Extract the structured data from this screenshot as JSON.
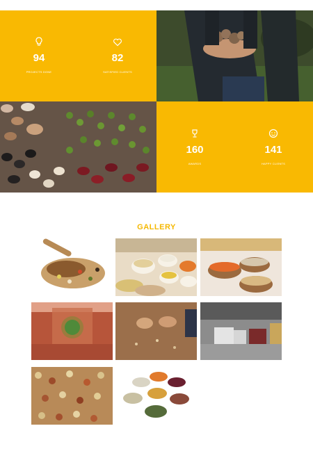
{
  "stats": [
    {
      "number": "94",
      "label": "PROJECTS DONE",
      "icon": "lightbulb-icon"
    },
    {
      "number": "82",
      "label": "SATISFIED CLIENTS",
      "icon": "heart-icon"
    },
    {
      "number": "160",
      "label": "AWARDS",
      "icon": "trophy-icon"
    },
    {
      "number": "141",
      "label": "HAPPY CLIENTS",
      "icon": "smiley-icon"
    }
  ],
  "gallery": {
    "title": "GALLERY"
  },
  "colors": {
    "accent": "#f9b902",
    "title": "#f5b800"
  }
}
